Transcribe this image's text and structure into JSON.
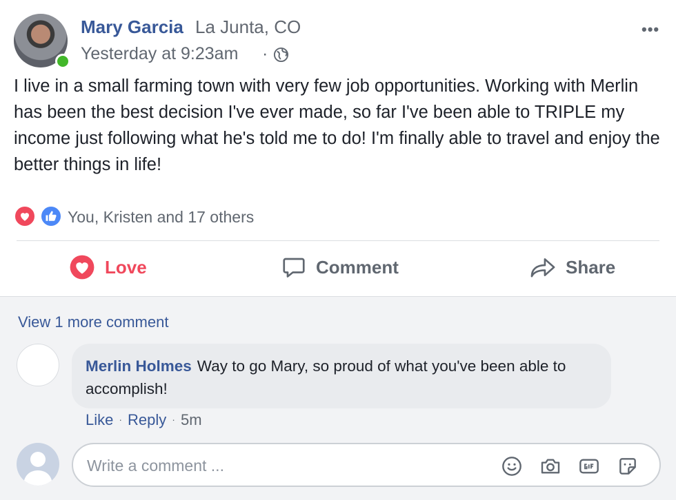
{
  "post": {
    "author": "Mary Garcia",
    "location": "La Junta, CO",
    "timestamp": "Yesterday at 9:23am",
    "separator": "·",
    "more_label": "•••",
    "text": "I live in a small farming town with very few job opportunities. Working with Merlin has been the best decision I've ever made, so far I've been able to TRIPLE my income just following what he's told me to do! I'm finally able to travel and enjoy the better things in life!",
    "reactions_text": "You, Kristen and 17 others",
    "actions": {
      "love": "Love",
      "comment": "Comment",
      "share": "Share"
    }
  },
  "comments": {
    "view_more": "View 1 more comment",
    "items": [
      {
        "author": "Merlin Holmes",
        "text": "Way to go Mary, so proud of what you've been able to accomplish!",
        "like_label": "Like",
        "reply_label": "Reply",
        "time": "5m"
      }
    ],
    "composer": {
      "placeholder": "Write a comment ..."
    }
  },
  "icons": {
    "love_reaction": "heart-icon",
    "like_reaction": "thumbs-up-icon",
    "globe": "globe-icon",
    "comment": "speech-bubble-icon",
    "share": "share-arrow-icon",
    "emoji": "smiley-icon",
    "camera": "camera-icon",
    "gif": "gif-icon",
    "sticker": "sticker-icon"
  },
  "colors": {
    "link_blue": "#385898",
    "love_red": "#f0485c",
    "like_blue": "#4c88f7",
    "online_green": "#42b72a",
    "muted_gray": "#606770"
  }
}
